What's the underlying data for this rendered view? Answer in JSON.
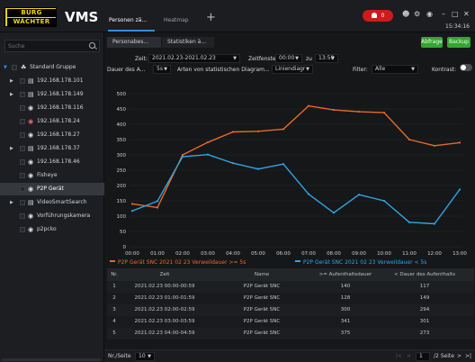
{
  "brand": {
    "logo_line1": "BURG",
    "logo_line2": "WÄCHTER",
    "app_name": "VMS"
  },
  "top_tabs": [
    {
      "label": "Personen zä..."
    },
    {
      "label": "Heatmap"
    }
  ],
  "top_icons": {
    "alert_count": "0",
    "clock": "15:34:16"
  },
  "sidebar": {
    "search_placeholder": "Suche",
    "items": [
      {
        "label": "Standard Gruppe"
      },
      {
        "label": "192.168.178.101"
      },
      {
        "label": "192.168.178.149"
      },
      {
        "label": "192.168.178.116"
      },
      {
        "label": "192.168.178.24"
      },
      {
        "label": "192.168.178.27"
      },
      {
        "label": "192.168.178.37"
      },
      {
        "label": "192.168.178.46"
      },
      {
        "label": "Fisheye"
      },
      {
        "label": "P2P Gerät"
      },
      {
        "label": "VideoSmartSearch"
      },
      {
        "label": "Vorführungskamera"
      },
      {
        "label": "p2pcko"
      }
    ]
  },
  "sub_tabs": [
    {
      "label": "Personabes..."
    },
    {
      "label": "Statistiken ä..."
    }
  ],
  "buttons": {
    "export": "Abfrage",
    "backup": "Backup"
  },
  "controls": {
    "time_label": "Zeit:",
    "time_value": "2021.02.23-2021.02.23",
    "window_label": "Zeitfenster:",
    "window_from": "00:00",
    "window_to_label": "zu",
    "window_to": "13:59",
    "duration_label": "Dauer des A...",
    "duration_value": "5s",
    "diagram_label": "Arten von statistischen Diagram...",
    "diagram_value": "Liniendiagr",
    "filter_label": "Filter:",
    "filter_value": "Alle",
    "contrast_label": "Kontrast:"
  },
  "chart_data": {
    "type": "line",
    "categories": [
      "00:00",
      "01:00",
      "02:00",
      "03:00",
      "04:00",
      "05:00",
      "06:00",
      "07:00",
      "08:00",
      "09:00",
      "10:00",
      "11:00",
      "12:00",
      "13:00"
    ],
    "yticks": [
      0,
      50,
      100,
      150,
      200,
      250,
      300,
      350,
      400,
      450,
      500
    ],
    "ylim": [
      0,
      500
    ],
    "grid": true,
    "series": [
      {
        "name": "P2P Gerät SNC 2021 02 23 Verweildauer >= 5s",
        "color": "#e8692a",
        "values": [
          140,
          128,
          300,
          341,
          375,
          377,
          384,
          460,
          447,
          441,
          438,
          350,
          330,
          340
        ]
      },
      {
        "name": "P2P Gerät SNC 2021 02 23 Verweildauer < 5s",
        "color": "#2ea6e6",
        "values": [
          117,
          149,
          294,
          301,
          273,
          254,
          270,
          172,
          111,
          170,
          150,
          80,
          75,
          187
        ]
      }
    ]
  },
  "table": {
    "headers": [
      "Nr.",
      "Zeit",
      "Name",
      ">= Aufenthaltsdauer",
      "< Dauer des Aufenthalts"
    ],
    "rows": [
      [
        "1",
        "2021.02.23 00:00-00:59",
        "P2P Gerät SNC",
        "140",
        "117"
      ],
      [
        "2",
        "2021.02.23 01:00-01:59",
        "P2P Gerät SNC",
        "128",
        "149"
      ],
      [
        "3",
        "2021.02.23 02:00-02:59",
        "P2P Gerät SNC",
        "300",
        "294"
      ],
      [
        "4",
        "2021.02.23 03:00-03:59",
        "P2P Gerät SNC",
        "341",
        "301"
      ],
      [
        "5",
        "2021.02.23 04:00-04:59",
        "P2P Gerät SNC",
        "375",
        "273"
      ]
    ]
  },
  "pagination": {
    "per_page_label": "Nr./Seite",
    "per_page_value": "10",
    "current_page": "1",
    "total_pages": "/2 Seite"
  }
}
